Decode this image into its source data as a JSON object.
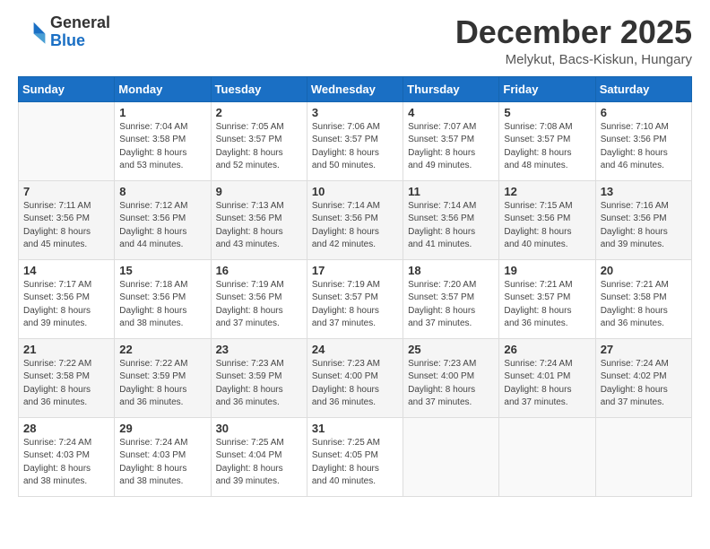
{
  "logo": {
    "general": "General",
    "blue": "Blue"
  },
  "header": {
    "month": "December 2025",
    "location": "Melykut, Bacs-Kiskun, Hungary"
  },
  "weekdays": [
    "Sunday",
    "Monday",
    "Tuesday",
    "Wednesday",
    "Thursday",
    "Friday",
    "Saturday"
  ],
  "weeks": [
    [
      {
        "day": "",
        "info": ""
      },
      {
        "day": "1",
        "info": "Sunrise: 7:04 AM\nSunset: 3:58 PM\nDaylight: 8 hours\nand 53 minutes."
      },
      {
        "day": "2",
        "info": "Sunrise: 7:05 AM\nSunset: 3:57 PM\nDaylight: 8 hours\nand 52 minutes."
      },
      {
        "day": "3",
        "info": "Sunrise: 7:06 AM\nSunset: 3:57 PM\nDaylight: 8 hours\nand 50 minutes."
      },
      {
        "day": "4",
        "info": "Sunrise: 7:07 AM\nSunset: 3:57 PM\nDaylight: 8 hours\nand 49 minutes."
      },
      {
        "day": "5",
        "info": "Sunrise: 7:08 AM\nSunset: 3:57 PM\nDaylight: 8 hours\nand 48 minutes."
      },
      {
        "day": "6",
        "info": "Sunrise: 7:10 AM\nSunset: 3:56 PM\nDaylight: 8 hours\nand 46 minutes."
      }
    ],
    [
      {
        "day": "7",
        "info": "Sunrise: 7:11 AM\nSunset: 3:56 PM\nDaylight: 8 hours\nand 45 minutes."
      },
      {
        "day": "8",
        "info": "Sunrise: 7:12 AM\nSunset: 3:56 PM\nDaylight: 8 hours\nand 44 minutes."
      },
      {
        "day": "9",
        "info": "Sunrise: 7:13 AM\nSunset: 3:56 PM\nDaylight: 8 hours\nand 43 minutes."
      },
      {
        "day": "10",
        "info": "Sunrise: 7:14 AM\nSunset: 3:56 PM\nDaylight: 8 hours\nand 42 minutes."
      },
      {
        "day": "11",
        "info": "Sunrise: 7:14 AM\nSunset: 3:56 PM\nDaylight: 8 hours\nand 41 minutes."
      },
      {
        "day": "12",
        "info": "Sunrise: 7:15 AM\nSunset: 3:56 PM\nDaylight: 8 hours\nand 40 minutes."
      },
      {
        "day": "13",
        "info": "Sunrise: 7:16 AM\nSunset: 3:56 PM\nDaylight: 8 hours\nand 39 minutes."
      }
    ],
    [
      {
        "day": "14",
        "info": "Sunrise: 7:17 AM\nSunset: 3:56 PM\nDaylight: 8 hours\nand 39 minutes."
      },
      {
        "day": "15",
        "info": "Sunrise: 7:18 AM\nSunset: 3:56 PM\nDaylight: 8 hours\nand 38 minutes."
      },
      {
        "day": "16",
        "info": "Sunrise: 7:19 AM\nSunset: 3:56 PM\nDaylight: 8 hours\nand 37 minutes."
      },
      {
        "day": "17",
        "info": "Sunrise: 7:19 AM\nSunset: 3:57 PM\nDaylight: 8 hours\nand 37 minutes."
      },
      {
        "day": "18",
        "info": "Sunrise: 7:20 AM\nSunset: 3:57 PM\nDaylight: 8 hours\nand 37 minutes."
      },
      {
        "day": "19",
        "info": "Sunrise: 7:21 AM\nSunset: 3:57 PM\nDaylight: 8 hours\nand 36 minutes."
      },
      {
        "day": "20",
        "info": "Sunrise: 7:21 AM\nSunset: 3:58 PM\nDaylight: 8 hours\nand 36 minutes."
      }
    ],
    [
      {
        "day": "21",
        "info": "Sunrise: 7:22 AM\nSunset: 3:58 PM\nDaylight: 8 hours\nand 36 minutes."
      },
      {
        "day": "22",
        "info": "Sunrise: 7:22 AM\nSunset: 3:59 PM\nDaylight: 8 hours\nand 36 minutes."
      },
      {
        "day": "23",
        "info": "Sunrise: 7:23 AM\nSunset: 3:59 PM\nDaylight: 8 hours\nand 36 minutes."
      },
      {
        "day": "24",
        "info": "Sunrise: 7:23 AM\nSunset: 4:00 PM\nDaylight: 8 hours\nand 36 minutes."
      },
      {
        "day": "25",
        "info": "Sunrise: 7:23 AM\nSunset: 4:00 PM\nDaylight: 8 hours\nand 37 minutes."
      },
      {
        "day": "26",
        "info": "Sunrise: 7:24 AM\nSunset: 4:01 PM\nDaylight: 8 hours\nand 37 minutes."
      },
      {
        "day": "27",
        "info": "Sunrise: 7:24 AM\nSunset: 4:02 PM\nDaylight: 8 hours\nand 37 minutes."
      }
    ],
    [
      {
        "day": "28",
        "info": "Sunrise: 7:24 AM\nSunset: 4:03 PM\nDaylight: 8 hours\nand 38 minutes."
      },
      {
        "day": "29",
        "info": "Sunrise: 7:24 AM\nSunset: 4:03 PM\nDaylight: 8 hours\nand 38 minutes."
      },
      {
        "day": "30",
        "info": "Sunrise: 7:25 AM\nSunset: 4:04 PM\nDaylight: 8 hours\nand 39 minutes."
      },
      {
        "day": "31",
        "info": "Sunrise: 7:25 AM\nSunset: 4:05 PM\nDaylight: 8 hours\nand 40 minutes."
      },
      {
        "day": "",
        "info": ""
      },
      {
        "day": "",
        "info": ""
      },
      {
        "day": "",
        "info": ""
      }
    ]
  ]
}
